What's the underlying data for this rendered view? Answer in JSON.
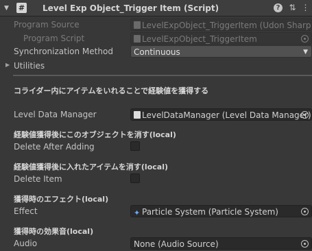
{
  "header": {
    "title": "Level Exp Object_Trigger Item (Script)",
    "collapse_glyph": "▼",
    "script_icon_glyph": "#",
    "help_glyph": "?",
    "presets_glyph": "⇅",
    "more_glyph": "⋮"
  },
  "program_source": {
    "label": "Program Source",
    "value": "LevelExpObject_TriggerItem (Udon Sharp"
  },
  "program_script": {
    "label": "Program Script",
    "value": "LevelExpObject_TriggerItem"
  },
  "sync": {
    "label": "Synchronization Method",
    "value": "Continuous",
    "arrow": "▼"
  },
  "utilities": {
    "label": "Utilities",
    "arrow": "▶"
  },
  "description": "コライダー内にアイテムをいれることで経験値を獲得する",
  "level_data_manager": {
    "label": "Level Data Manager",
    "value": "LevelDataManager (Level Data Manager)"
  },
  "section_delete_after": {
    "heading": "経験値獲得後にこのオブジェクトを消す(local)",
    "label": "Delete After Adding",
    "checked": false
  },
  "section_delete_item": {
    "heading": "経験値獲得後に入れたアイテムを消す(local)",
    "label": "Delete Item",
    "checked": false
  },
  "section_effect": {
    "heading": "獲得時のエフェクト(local)",
    "label": "Effect",
    "value": "Particle System (Particle System)",
    "icon_glyph": "✦"
  },
  "section_audio": {
    "heading": "獲得時の効果音(local)",
    "label": "Audio",
    "value": "None (Audio Source)"
  },
  "colors": {
    "background": "#383838",
    "field": "#2a2a2a",
    "text": "#c4c4c4",
    "particle_icon": "#6fa8ff"
  }
}
